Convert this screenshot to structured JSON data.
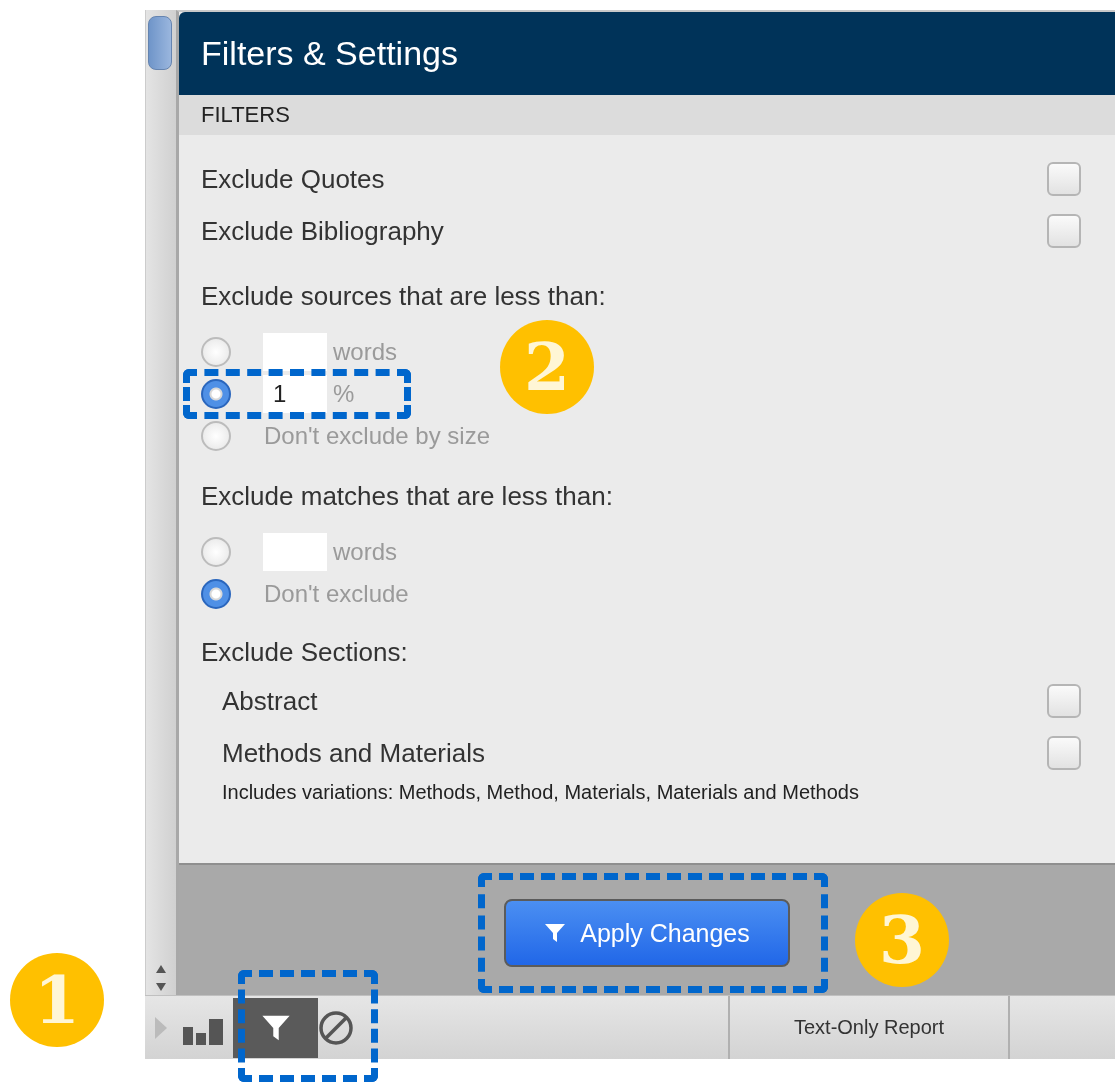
{
  "panel": {
    "title": "Filters & Settings",
    "section": "FILTERS",
    "toggles": [
      {
        "label": "Exclude Quotes",
        "checked": false
      },
      {
        "label": "Exclude Bibliography",
        "checked": false
      }
    ],
    "source_size": {
      "heading": "Exclude sources that are less than:",
      "options": [
        {
          "kind": "input",
          "unit": "words",
          "selected": false
        },
        {
          "kind": "input",
          "value": "1",
          "unit": "%",
          "selected": true
        },
        {
          "kind": "plain",
          "label": "Don't exclude by size",
          "selected": false
        }
      ]
    },
    "match_size": {
      "heading": "Exclude matches that are less than:",
      "options": [
        {
          "kind": "input",
          "unit": "words",
          "selected": false
        },
        {
          "kind": "plain",
          "label": "Don't exclude",
          "selected": true
        }
      ]
    },
    "sections": {
      "heading": "Exclude Sections:",
      "items": [
        {
          "label": "Abstract",
          "checked": false
        },
        {
          "label": "Methods and Materials",
          "checked": false,
          "note": "Includes variations: Methods, Method, Materials, Materials and Methods"
        }
      ]
    },
    "apply_button": "Apply Changes"
  },
  "toolbar": {
    "tools": [
      {
        "kind": "chart",
        "selected": false
      },
      {
        "kind": "filter",
        "selected": true
      },
      {
        "kind": "block",
        "selected": false
      }
    ],
    "report_tab": "Text-Only Report"
  },
  "callouts": [
    {
      "label": "1"
    },
    {
      "label": "2"
    },
    {
      "label": "3"
    }
  ]
}
